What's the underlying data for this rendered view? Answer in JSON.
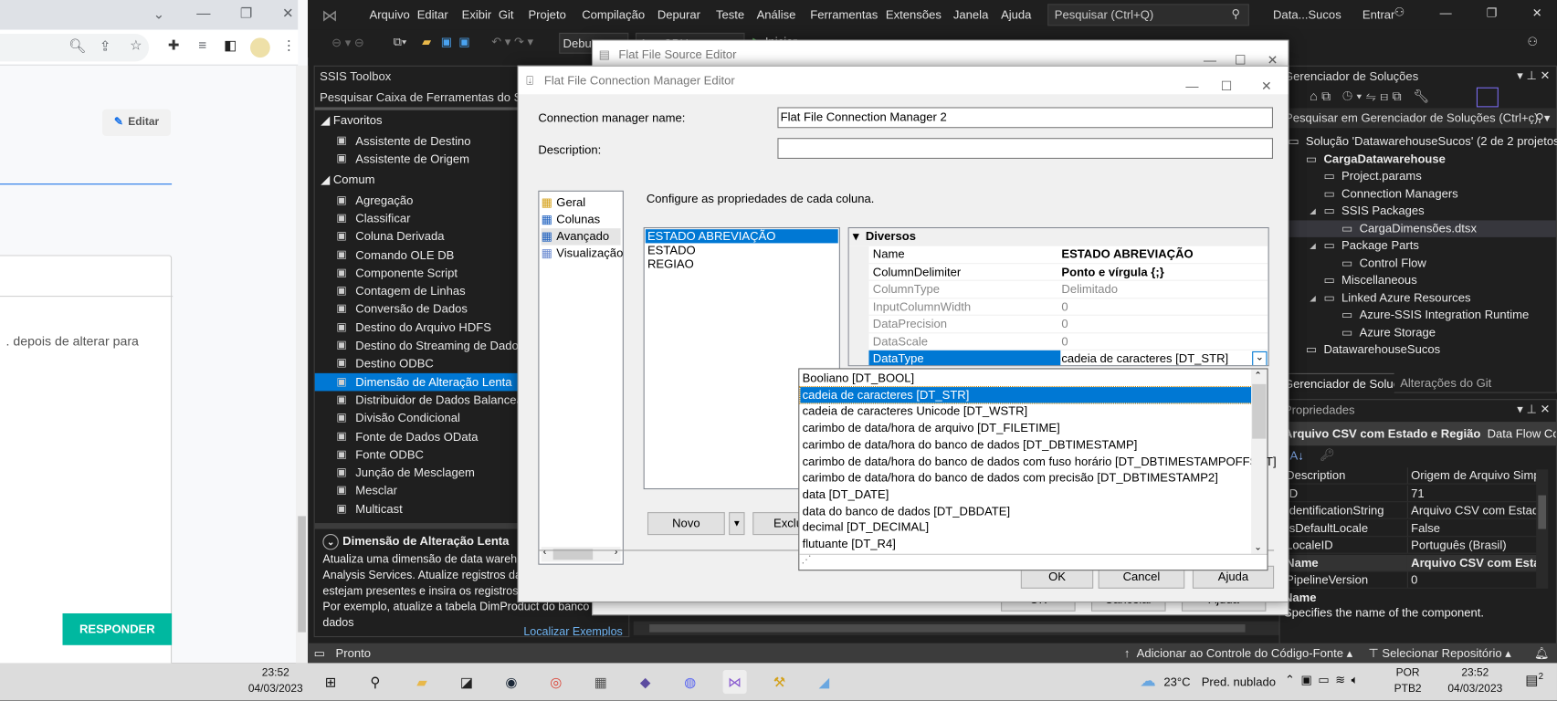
{
  "browser": {
    "edit_label": "Editar",
    "card_text": ". depois de alterar para",
    "respond_label": "RESPONDER",
    "title_icons": [
      "chevron-down-icon",
      "minimize-icon",
      "restore-icon",
      "close-icon"
    ],
    "toolbar_icons": [
      "zoom-out-icon",
      "share-icon",
      "star-icon",
      "extensions-icon",
      "media-icon",
      "sidebar-icon",
      "avatar",
      "menu-icon"
    ]
  },
  "vs": {
    "menu": [
      "Arquivo",
      "Editar",
      "Exibir",
      "Git",
      "Projeto",
      "Compilação",
      "Depurar",
      "Teste",
      "Análise",
      "Ferramentas",
      "Extensões",
      "Janela",
      "Ajuda"
    ],
    "search_placeholder": "Pesquisar (Ctrl+Q)",
    "solution_short": "Data...Sucos",
    "signin": "Entrar",
    "config_combo": "Debug",
    "platform_combo": "Any CPU",
    "start_label": "Iniciar",
    "toolbox": {
      "title": "SSIS Toolbox",
      "search": "Pesquisar Caixa de Ferramentas do SSIS",
      "groups": [
        {
          "label": "Favoritos",
          "items": [
            "Assistente de Destino",
            "Assistente de Origem"
          ]
        },
        {
          "label": "Comum",
          "items": [
            "Agregação",
            "Classificar",
            "Coluna Derivada",
            "Comando OLE DB",
            "Componente Script",
            "Contagem de Linhas",
            "Conversão de Dados",
            "Destino do Arquivo HDFS",
            "Destino do Streaming de Dados",
            "Destino ODBC",
            "Dimensão de Alteração Lenta",
            "Distribuidor de Dados Balanceados",
            "Divisão Condicional",
            "Fonte de Dados OData",
            "Fonte ODBC",
            "Junção de Mesclagem",
            "Mesclar",
            "Multicast"
          ]
        }
      ],
      "selected": "Dimensão de Alteração Lenta",
      "desc_title": "Dimensão de Alteração Lenta",
      "desc_text": "Atualiza uma dimensão de data warehouse no SQL Server Analysis Services. Atualize registros da dimensão que já estejam presentes e insira os registros que não estejam. Por exemplo, atualize a tabela DimProduct do banco de dados",
      "link": "Localizar Exemplos"
    },
    "solution_explorer": {
      "title": "Gerenciador de Soluções",
      "search": "Pesquisar em Gerenciador de Soluções (Ctrl+ç)",
      "items": [
        {
          "label": "Solução 'DatawarehouseSucos' (2 de 2 projetos)",
          "level": 0
        },
        {
          "label": "CargaDatawarehouse",
          "level": 1,
          "bold": true
        },
        {
          "label": "Project.params",
          "level": 2
        },
        {
          "label": "Connection Managers",
          "level": 2
        },
        {
          "label": "SSIS Packages",
          "level": 2,
          "expanded": true
        },
        {
          "label": "CargaDimensões.dtsx",
          "level": 3,
          "selected": true
        },
        {
          "label": "Package Parts",
          "level": 2,
          "expanded": true
        },
        {
          "label": "Control Flow",
          "level": 3
        },
        {
          "label": "Miscellaneous",
          "level": 2
        },
        {
          "label": "Linked Azure Resources",
          "level": 2,
          "expanded": true
        },
        {
          "label": "Azure-SSIS Integration Runtime",
          "level": 3
        },
        {
          "label": "Azure Storage",
          "level": 3
        },
        {
          "label": "DatawarehouseSucos",
          "level": 1
        }
      ],
      "tabs": [
        "Gerenciador de Soluções",
        "Alterações do Git"
      ]
    },
    "properties": {
      "title": "Propriedades",
      "object": "Arquivo CSV com Estado e Região",
      "object_type": "Data Flow Component",
      "rows": [
        [
          "Description",
          "Origem de Arquivo Simples"
        ],
        [
          "ID",
          "71"
        ],
        [
          "IdentificationString",
          "Arquivo CSV com Estado e Região"
        ],
        [
          "IsDefaultLocale",
          "False"
        ],
        [
          "LocaleID",
          "Português (Brasil)"
        ],
        [
          "Name",
          "Arquivo CSV com Estado e Região"
        ],
        [
          "PipelineVersion",
          "0"
        ]
      ],
      "selected_row": "Name",
      "desc_title": "Name",
      "desc_text": "Specifies the name of the component."
    },
    "status": {
      "left": "Pronto",
      "source_control": "Adicionar ao Controle do Código-Fonte",
      "repo": "Selecionar Repositório"
    }
  },
  "source_editor": {
    "title": "Flat File Source Editor",
    "buttons": [
      "OK",
      "Cancelar",
      "Ajuda"
    ]
  },
  "conn_editor": {
    "title": "Flat File Connection Manager Editor",
    "name_label": "Connection manager name:",
    "name_value": "Flat File Connection Manager 2",
    "desc_label": "Description:",
    "desc_value": "",
    "nav": [
      "Geral",
      "Colunas",
      "Avançado",
      "Visualização"
    ],
    "nav_selected": "Avançado",
    "instructions": "Configure as propriedades de cada coluna.",
    "columns": [
      "ESTADO ABREVIAÇÃO",
      "ESTADO",
      "REGIAO"
    ],
    "column_selected": "ESTADO ABREVIAÇÃO",
    "grid_category": "Diversos",
    "grid": [
      [
        "Name",
        "ESTADO ABREVIAÇÃO",
        true,
        false
      ],
      [
        "ColumnDelimiter",
        "Ponto e vírgula {;}",
        true,
        false
      ],
      [
        "ColumnType",
        "Delimitado",
        false,
        true
      ],
      [
        "InputColumnWidth",
        "0",
        false,
        true
      ],
      [
        "DataPrecision",
        "0",
        false,
        true
      ],
      [
        "DataScale",
        "0",
        false,
        true
      ],
      [
        "DataType",
        "cadeia de caracteres [DT_STR]",
        false,
        false
      ]
    ],
    "datatype_options": [
      "Booliano [DT_BOOL]",
      "cadeia de caracteres [DT_STR]",
      "cadeia de caracteres Unicode [DT_WSTR]",
      "carimbo de data/hora de arquivo [DT_FILETIME]",
      "carimbo de data/hora do banco de dados [DT_DBTIMESTAMP]",
      "carimbo de data/hora do banco de dados com fuso horário [DT_DBTIMESTAMPOFFSET]",
      "carimbo de data/hora do banco de dados com precisão [DT_DBTIMESTAMP2]",
      "data [DT_DATE]",
      "data do banco de dados [DT_DBDATE]",
      "decimal [DT_DECIMAL]",
      "flutuante [DT_R4]"
    ],
    "datatype_selected": "cadeia de caracteres [DT_STR]",
    "new_label": "Novo",
    "delete_label": "Excluir",
    "ok": "OK",
    "cancel": "Cancel",
    "help": "Ajuda"
  },
  "taskbar": {
    "left_time": "23:52",
    "left_date": "04/03/2023",
    "apps": [
      "start-icon",
      "search-icon",
      "file-explorer-icon",
      "sticky-app-icon",
      "steam-icon",
      "chrome-icon",
      "calculator-icon",
      "app-icon",
      "discord-icon",
      "visual-studio-icon",
      "ssis-tool-icon",
      "app2-icon"
    ],
    "weather": "23°C",
    "weather_text": "Pred. nublado",
    "lang1": "POR",
    "lang2": "PTB2",
    "time": "23:52",
    "date": "04/03/2023",
    "notifications": "2"
  },
  "colors": {
    "accent": "#0078d4",
    "respond": "#00b8a0",
    "vs_bg": "#1f1f1f"
  }
}
